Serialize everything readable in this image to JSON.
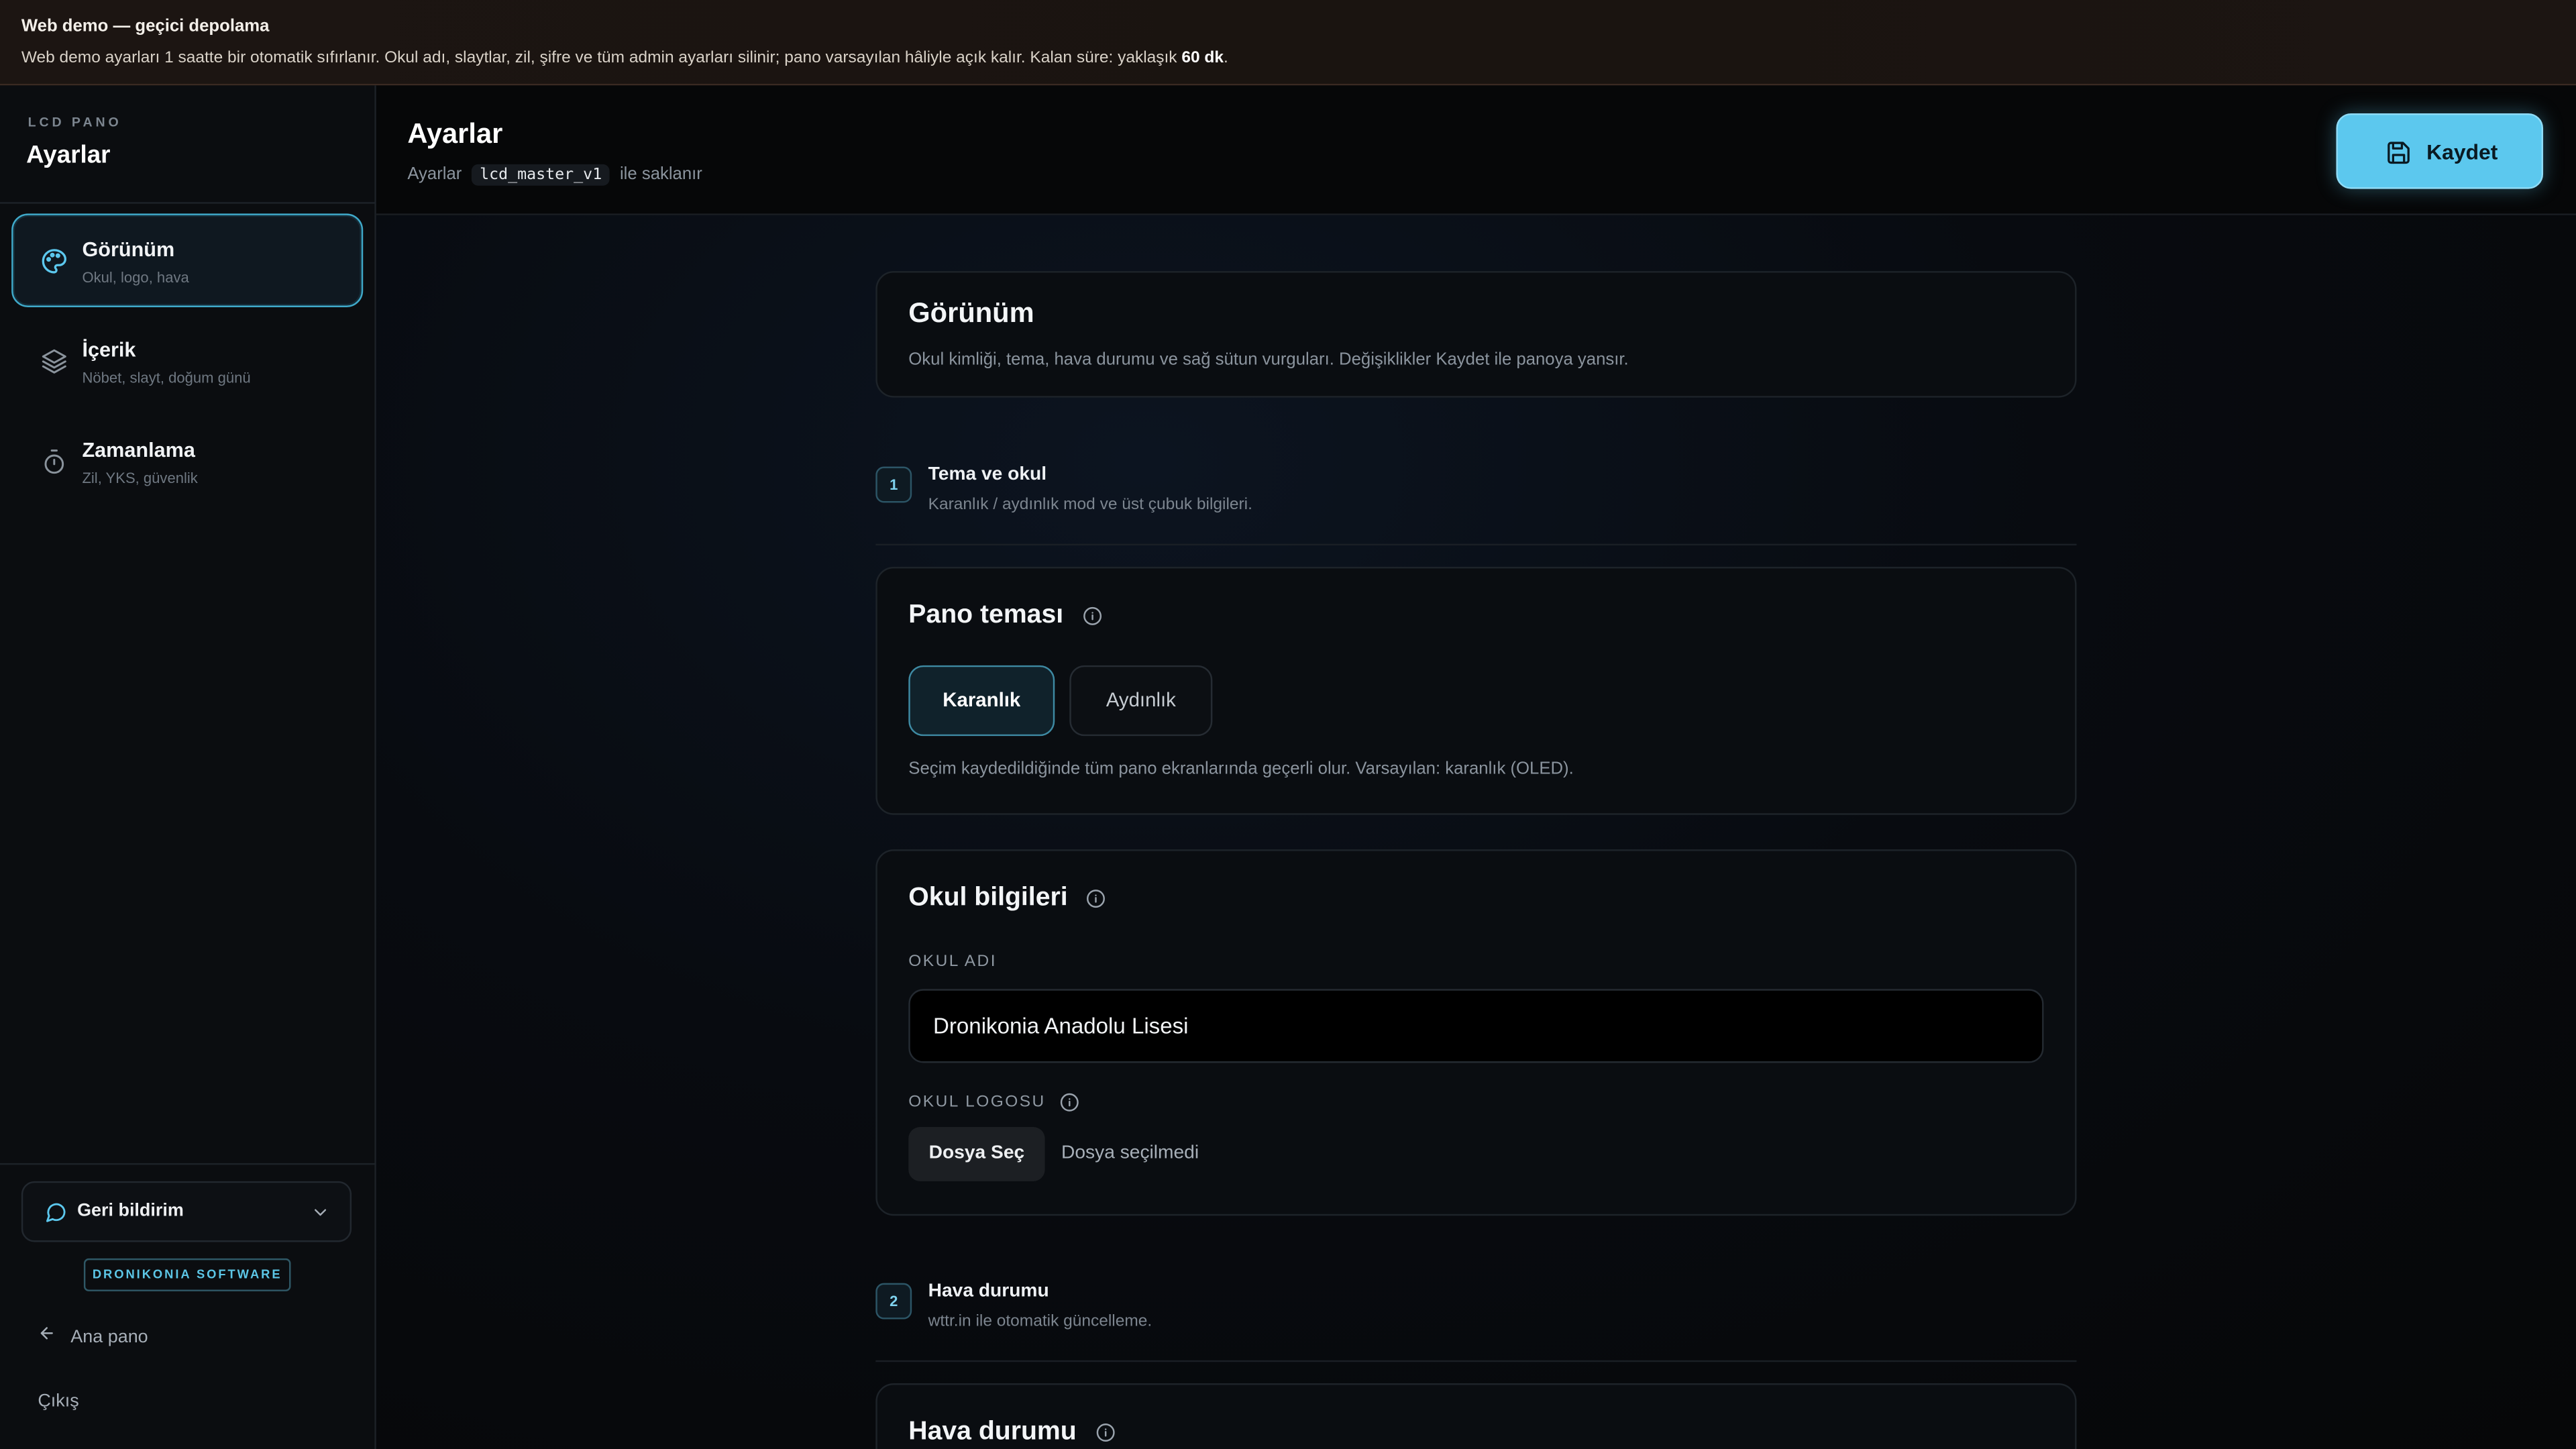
{
  "banner": {
    "title": "Web demo — geçici depolama",
    "text": "Web demo ayarları 1 saatte bir otomatik sıfırlanır. Okul adı, slaytlar, zil, şifre ve tüm admin ayarları silinir; pano varsayılan hâliyle açık kalır. Kalan süre: yaklaşık ",
    "remaining": "60 dk",
    "suffix": "."
  },
  "sidebar": {
    "brand_small": "LCD PANO",
    "brand_title": "Ayarlar",
    "items": [
      {
        "label": "Görünüm",
        "sub": "Okul, logo, hava",
        "icon": "palette-icon",
        "active": true
      },
      {
        "label": "İçerik",
        "sub": "Nöbet, slayt, doğum günü",
        "icon": "layers-icon",
        "active": false
      },
      {
        "label": "Zamanlama",
        "sub": "Zil, YKS, güvenlik",
        "icon": "timer-icon",
        "active": false
      }
    ],
    "feedback_label": "Geri bildirim",
    "badge": "DRONIKONIA SOFTWARE",
    "back_label": "Ana pano",
    "logout_label": "Çıkış"
  },
  "header": {
    "title": "Ayarlar",
    "sub_prefix": "Ayarlar",
    "sub_code": "lcd_master_v1",
    "sub_suffix": "ile saklanır",
    "save_label": "Kaydet"
  },
  "main": {
    "section_title": "Görünüm",
    "section_desc": "Okul kimliği, tema, hava durumu ve sağ sütun vurguları. Değişiklikler Kaydet ile panoya yansır.",
    "step1": {
      "num": "1",
      "title": "Tema ve okul",
      "sub": "Karanlık / aydınlık mod ve üst çubuk bilgileri."
    },
    "theme_card": {
      "title": "Pano teması",
      "option_dark": "Karanlık",
      "option_light": "Aydınlık",
      "note": "Seçim kaydedildiğinde tüm pano ekranlarında geçerli olur. Varsayılan: karanlık (OLED)."
    },
    "school_card": {
      "title": "Okul bilgileri",
      "name_label": "OKUL ADI",
      "name_value": "Dronikonia Anadolu Lisesi",
      "logo_label": "OKUL LOGOSU",
      "file_button": "Dosya Seç",
      "file_status": "Dosya seçilmedi"
    },
    "step2": {
      "num": "2",
      "title": "Hava durumu",
      "sub": "wttr.in ile otomatik güncelleme."
    },
    "weather_card": {
      "title": "Hava durumu"
    }
  },
  "colors": {
    "accent": "#5cc8ee",
    "background": "#060708",
    "sidebar": "#0b0d10"
  }
}
